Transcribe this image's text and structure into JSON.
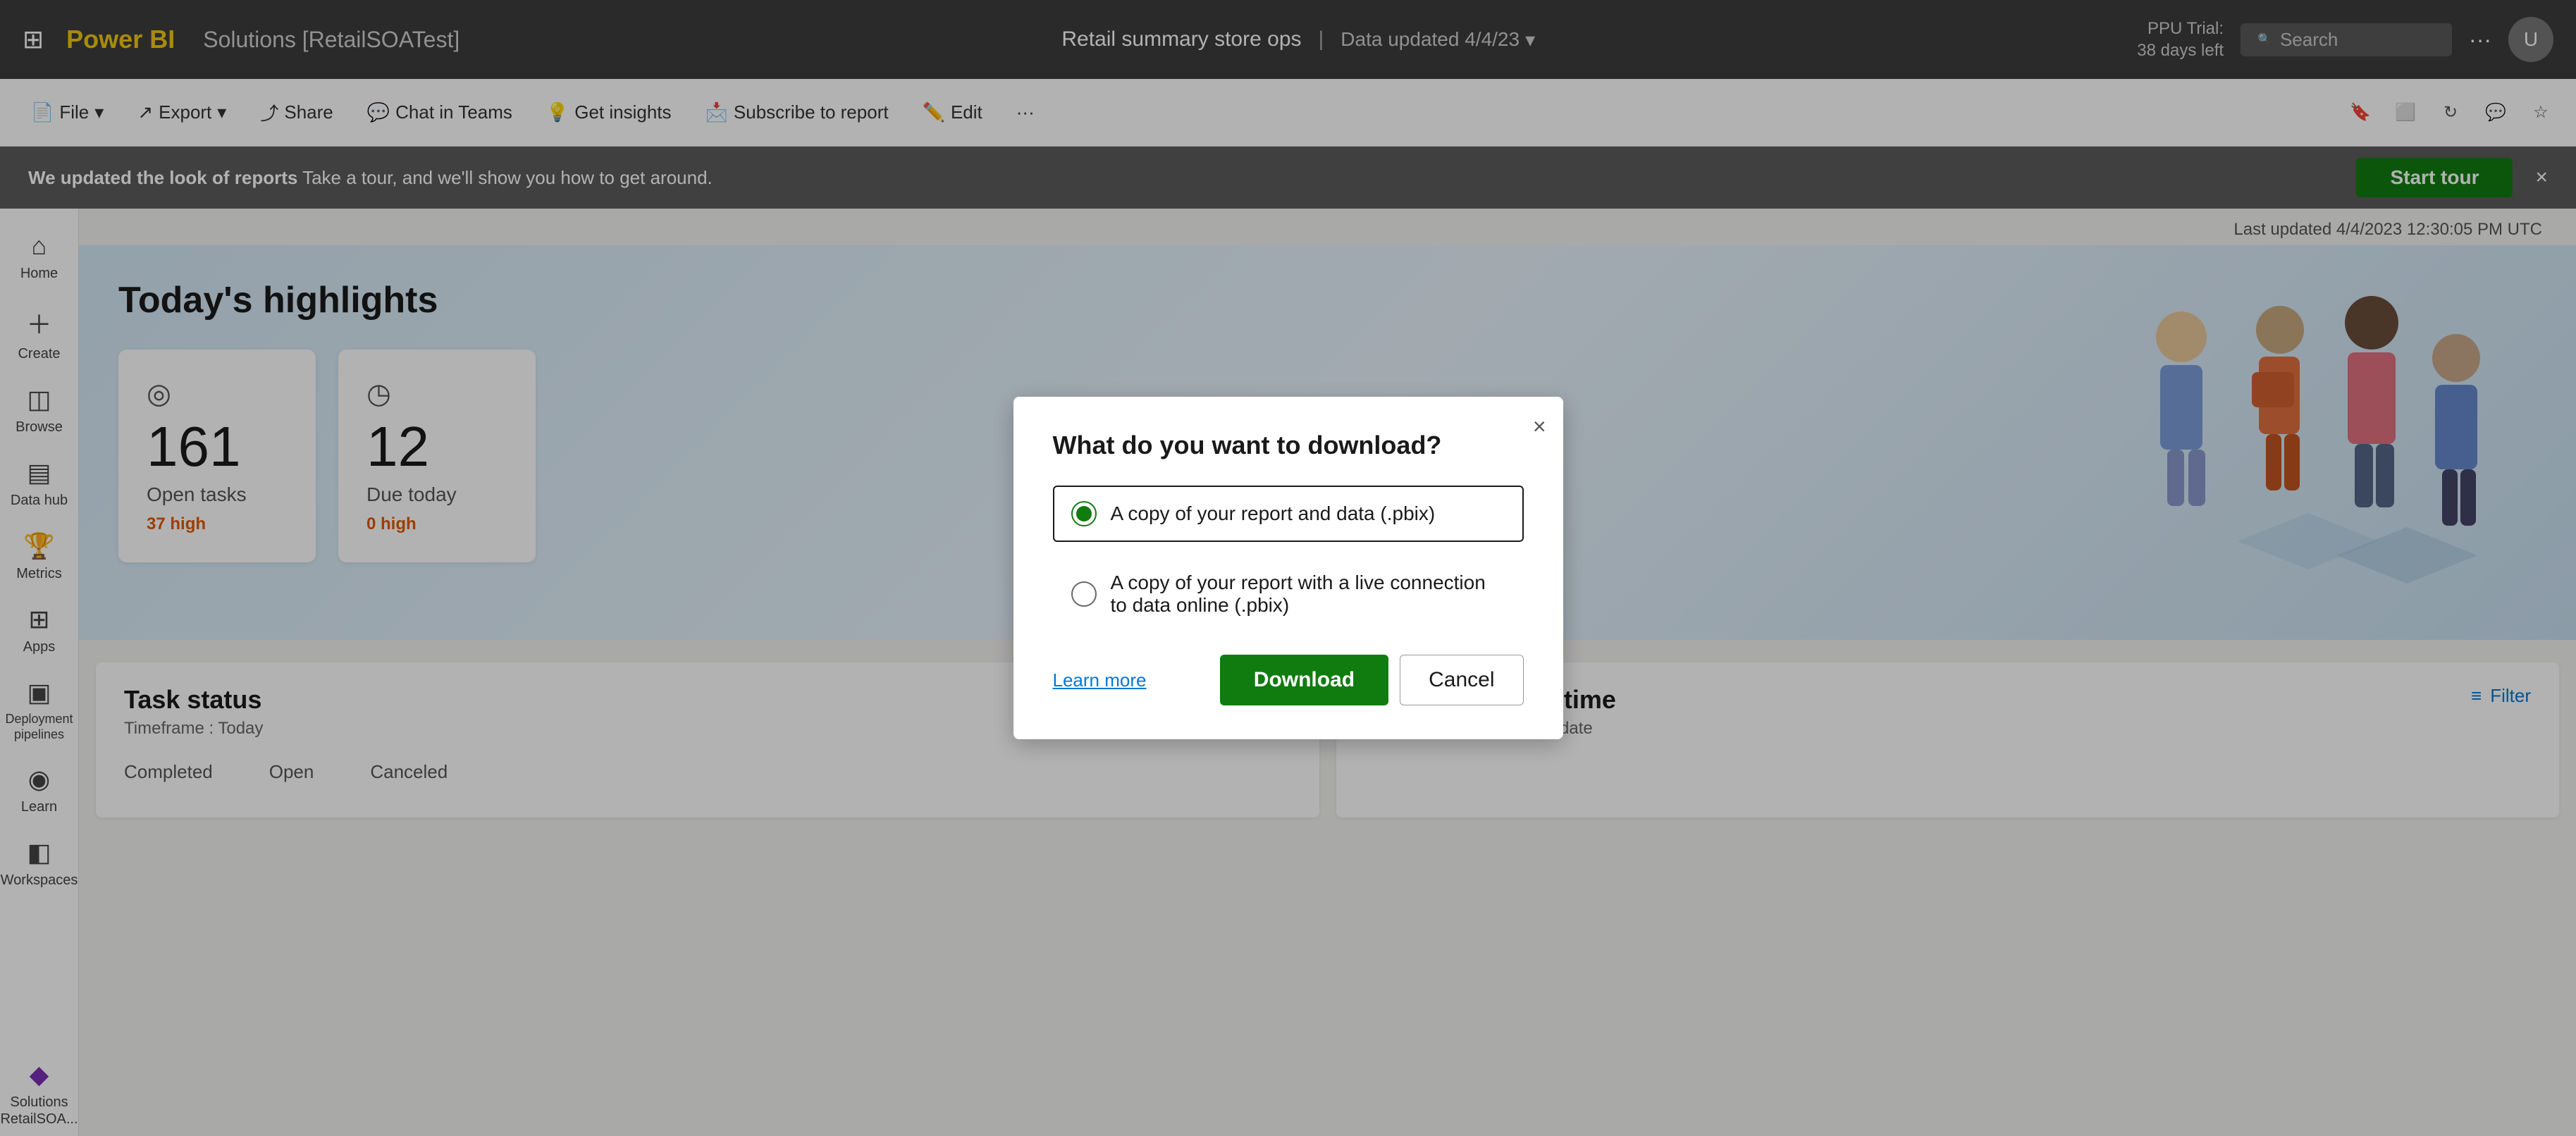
{
  "topNav": {
    "gridIconLabel": "⊞",
    "logoText": "Power BI",
    "workspaceName": "Solutions [RetailSOATest]",
    "reportTitle": "Retail summary store ops",
    "separator": "|",
    "dataUpdated": "Data updated 4/4/23",
    "ppuTrial": "PPU Trial:",
    "daysLeft": "38 days left",
    "searchPlaceholder": "Search",
    "moreIconLabel": "···",
    "avatarLabel": "U"
  },
  "toolbar": {
    "fileLabel": "File",
    "exportLabel": "Export",
    "shareLabel": "Share",
    "chatInTeamsLabel": "Chat in Teams",
    "getInsightsLabel": "Get insights",
    "subscribeLabel": "Subscribe to report",
    "editLabel": "Edit",
    "moreLabel": "···"
  },
  "banner": {
    "boldText": "We updated the look of reports",
    "normalText": "  Take a tour, and we'll show you how to get around.",
    "startTourLabel": "Start tour",
    "closeLabel": "×"
  },
  "sidebar": {
    "items": [
      {
        "id": "home",
        "icon": "⌂",
        "label": "Home"
      },
      {
        "id": "create",
        "icon": "+",
        "label": "Create"
      },
      {
        "id": "browse",
        "icon": "◫",
        "label": "Browse"
      },
      {
        "id": "data-hub",
        "icon": "≡",
        "label": "Data hub"
      },
      {
        "id": "metrics",
        "icon": "🏆",
        "label": "Metrics"
      },
      {
        "id": "apps",
        "icon": "⊞",
        "label": "Apps"
      },
      {
        "id": "deployment-pipelines",
        "icon": "▣",
        "label": "Deployment pipelines"
      },
      {
        "id": "learn",
        "icon": "◉",
        "label": "Learn"
      },
      {
        "id": "workspaces",
        "icon": "◧",
        "label": "Workspaces"
      },
      {
        "id": "solutions",
        "icon": "◆",
        "label": "Solutions RetailSOA..."
      }
    ]
  },
  "lastUpdated": "Last updated 4/4/2023 12:30:05 PM UTC",
  "highlights": {
    "title": "Today's highlights",
    "cards": [
      {
        "icon": "◎",
        "number": "161",
        "label": "Open tasks",
        "sub": "37 high"
      },
      {
        "icon": "◷",
        "number": "12",
        "label": "Due today",
        "sub": "0 high"
      }
    ]
  },
  "taskStatus": {
    "title": "Task status",
    "subtitle": "Timeframe : Today",
    "filterLabel": "Filter",
    "columns": [
      "Completed",
      "Open",
      "Canceled"
    ]
  },
  "taskCountOverTime": {
    "title": "Task count over time",
    "subtitle": "Based on scheduled start date",
    "filterLabel": "Filter"
  },
  "modal": {
    "title": "What do you want to download?",
    "closeLabel": "×",
    "option1": "A copy of your report and data (.pbix)",
    "option2": "A copy of your report with a live connection to data online (.pbix)",
    "learnMoreLabel": "Learn more",
    "downloadLabel": "Download",
    "cancelLabel": "Cancel"
  }
}
